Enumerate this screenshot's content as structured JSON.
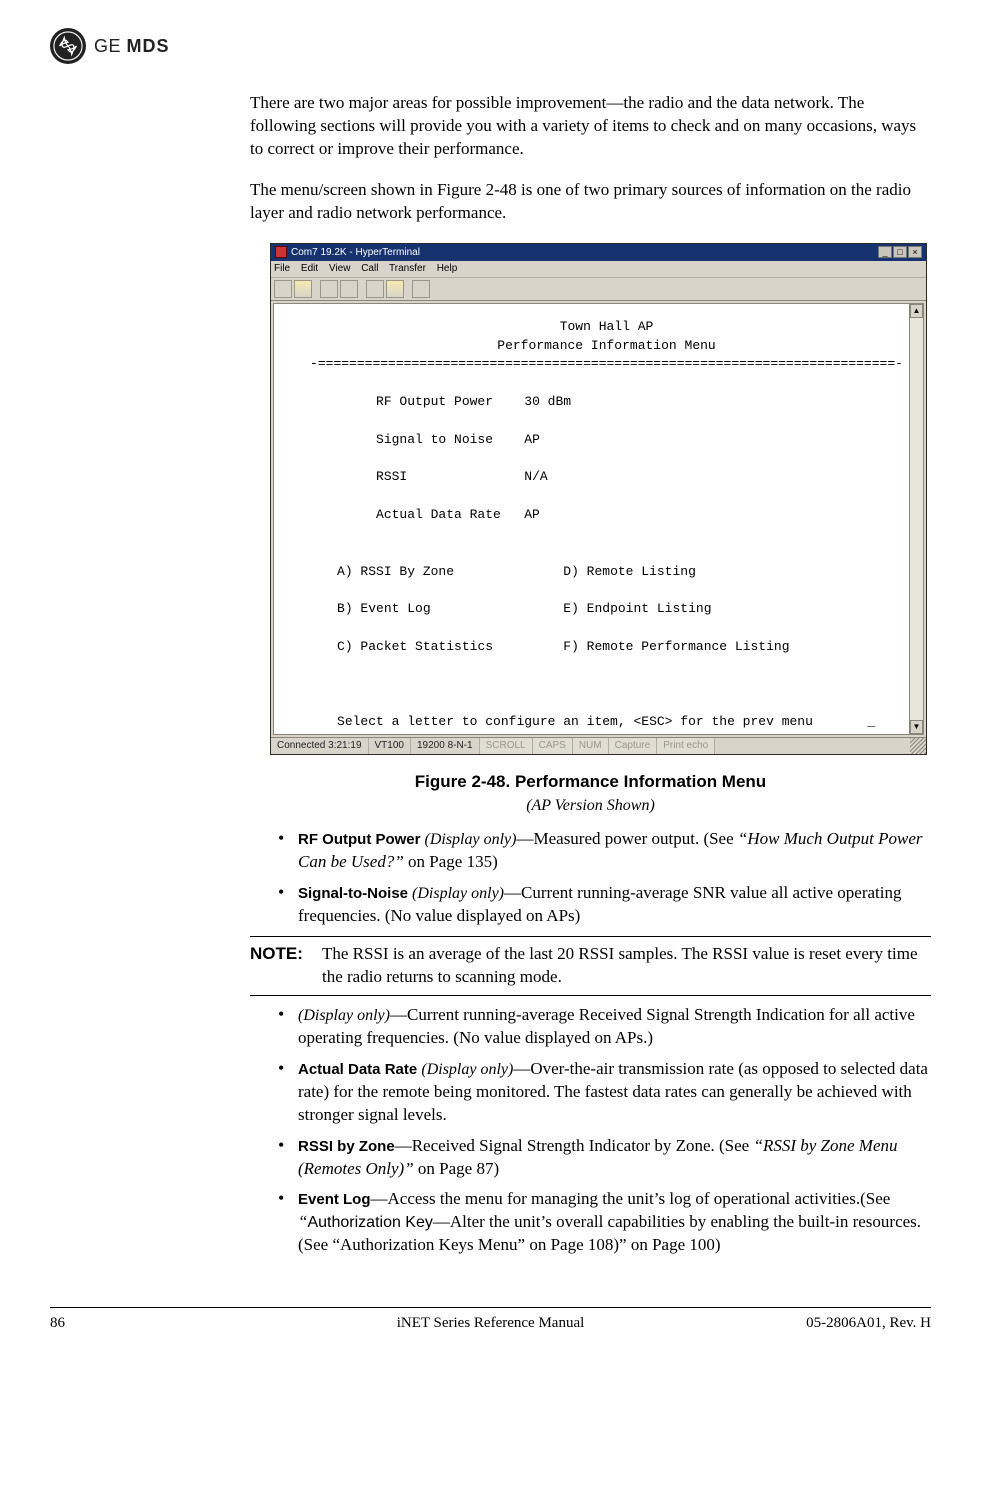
{
  "header": {
    "brand_ge": "GE",
    "brand_mds": "MDS"
  },
  "intro": {
    "p1": "There are two major areas for possible improvement—the radio and the data network. The following sections will provide you with a variety of items to check and on many occasions, ways to correct or improve their performance.",
    "p2": "The menu/screen shown in Figure 2-48 is one of two primary sources of information on the radio layer and radio network performance."
  },
  "terminal": {
    "window_title": "Com7 19.2K - HyperTerminal",
    "menus": {
      "m1": "File",
      "m2": "Edit",
      "m3": "View",
      "m4": "Call",
      "m5": "Transfer",
      "m6": "Help"
    },
    "title_line": "Town Hall AP",
    "subtitle_line": "Performance Information Menu",
    "dash_line": "-==========================================================================-",
    "rows": {
      "r1a": "RF Output Power",
      "r1b": "30 dBm",
      "r2a": "Signal to Noise",
      "r2b": "AP",
      "r3a": "RSSI",
      "r3b": "N/A",
      "r4a": "Actual Data Rate",
      "r4b": "AP"
    },
    "opts": {
      "a": "A) RSSI By Zone",
      "d": "D) Remote Listing",
      "b": "B) Event Log",
      "e": "E) Endpoint Listing",
      "c": "C) Packet Statistics",
      "f": "F) Remote Performance Listing"
    },
    "prompt": "Select a letter to configure an item, <ESC> for the prev menu",
    "cursor": "_",
    "status": {
      "s1": "Connected 3:21:19",
      "s2": "VT100",
      "s3": "19200 8-N-1",
      "s4": "SCROLL",
      "s5": "CAPS",
      "s6": "NUM",
      "s7": "Capture",
      "s8": "Print echo"
    }
  },
  "figure": {
    "title": "Figure 2-48. Performance Information Menu",
    "subtitle": "(AP Version Shown)"
  },
  "bullets": {
    "b1_label": "RF Output Power",
    "b1_disp": " (Display only)",
    "b1_text": "—Measured power output. (See ",
    "b1_quote": "“How Much Output Power Can be Used?”",
    "b1_tail": " on Page 135)",
    "b2_label": "Signal-to-Noise",
    "b2_disp": " (Display only)",
    "b2_text": "—Current running-average SNR value all active operating frequencies. (No value displayed on APs)",
    "b3_disp": "(Display only)",
    "b3_text": "—Current running-average Received Signal Strength Indication for all active operating frequencies. (No value displayed on APs.)",
    "b4_label": "Actual Data Rate ",
    "b4_disp": " (Display only)",
    "b4_text": "—Over-the-air transmission rate (as opposed to selected data rate) for the remote being monitored. The fastest data rates can generally be achieved with stronger signal levels.",
    "b5_label": "RSSI by Zone",
    "b5_text": "—Received Signal Strength Indicator by Zone. (See ",
    "b5_quote": "“RSSI by Zone Menu (Remotes Only)”",
    "b5_tail": " on Page 87)",
    "b6_label": "Event Log",
    "b6_text": "—Access the menu for managing the unit’s log of operational activities.(See ",
    "b6_quote_open": "“",
    "b6_authkey": "Authorization Key",
    "b6_mid": "—Alter the unit’s overall capabilities by enabling the built-in resources. (See “Authorization Keys Menu” on Page 108)” on Page 100)"
  },
  "note": {
    "label": "NOTE:",
    "text": "The RSSI is an average of the last 20 RSSI samples. The RSSI value is reset every time the radio returns to scanning mode."
  },
  "footer": {
    "left": "86",
    "center": "iNET Series Reference Manual",
    "right": "05-2806A01, Rev. H"
  }
}
